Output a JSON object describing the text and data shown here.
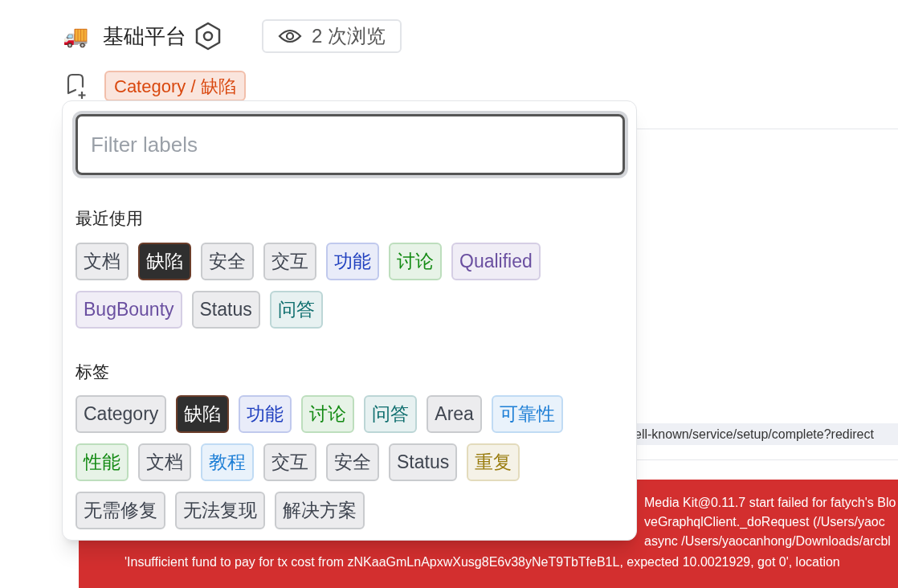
{
  "header": {
    "icon": "🚚",
    "title": "基础平台",
    "views": "2 次浏览"
  },
  "current_label": {
    "text": "Category / 缺陷",
    "color": "#d9480f"
  },
  "label_picker": {
    "filter": {
      "placeholder": "Filter labels"
    },
    "sections": [
      {
        "title": "最近使用",
        "labels": [
          {
            "text": "文档",
            "color": "#3f4550",
            "selected": false
          },
          {
            "text": "缺陷",
            "color": "#2f2f2f",
            "selected": true
          },
          {
            "text": "安全",
            "color": "#3f4550",
            "selected": false
          },
          {
            "text": "交互",
            "color": "#3f4550",
            "selected": false
          },
          {
            "text": "功能",
            "color": "#1f3fbf",
            "selected": false
          },
          {
            "text": "讨论",
            "color": "#138a13",
            "selected": false
          },
          {
            "text": "Qualified",
            "color": "#6a4fa0",
            "selected": false
          },
          {
            "text": "BugBounty",
            "color": "#6a4fa0",
            "selected": false
          },
          {
            "text": "Status",
            "color": "#3f4550",
            "selected": false
          },
          {
            "text": "问答",
            "color": "#0e6e6e",
            "selected": false
          }
        ]
      },
      {
        "title": "标签",
        "labels": [
          {
            "text": "Category",
            "color": "#3f4550",
            "selected": false
          },
          {
            "text": "缺陷",
            "color": "#2f2f2f",
            "selected": true
          },
          {
            "text": "功能",
            "color": "#1f3fbf",
            "selected": false
          },
          {
            "text": "讨论",
            "color": "#138a13",
            "selected": false
          },
          {
            "text": "问答",
            "color": "#0e6e6e",
            "selected": false
          },
          {
            "text": "Area",
            "color": "#3f4550",
            "selected": false
          },
          {
            "text": "可靠性",
            "color": "#1e7fd6",
            "selected": false
          },
          {
            "text": "性能",
            "color": "#138a13",
            "selected": false
          },
          {
            "text": "文档",
            "color": "#3f4550",
            "selected": false
          },
          {
            "text": "教程",
            "color": "#1e7fd6",
            "selected": false
          },
          {
            "text": "交互",
            "color": "#3f4550",
            "selected": false
          },
          {
            "text": "安全",
            "color": "#3f4550",
            "selected": false
          },
          {
            "text": "Status",
            "color": "#3f4550",
            "selected": false
          },
          {
            "text": "重复",
            "color": "#9a7d10",
            "selected": false
          },
          {
            "text": "无需修复",
            "color": "#3f4550",
            "selected": false
          },
          {
            "text": "无法复现",
            "color": "#3f4550",
            "selected": false
          },
          {
            "text": "解决方案",
            "color": "#3f4550",
            "selected": false
          }
        ]
      }
    ]
  },
  "background": {
    "url": "ell-known/service/setup/complete?redirect",
    "error_lines": [
      "Media Kit@0.11.7 start failed for fatych's Blo",
      "veGraphqlClient._doRequest (/Users/yaoc",
      "async /Users/yaocanhong/Downloads/arcbl",
      "'Insufficient fund to pay for tx cost from zNKaaGmLnApxwXusg8E6v38yNeT9TbTfeB1L, expected 10.0021929, got 0', location"
    ]
  }
}
